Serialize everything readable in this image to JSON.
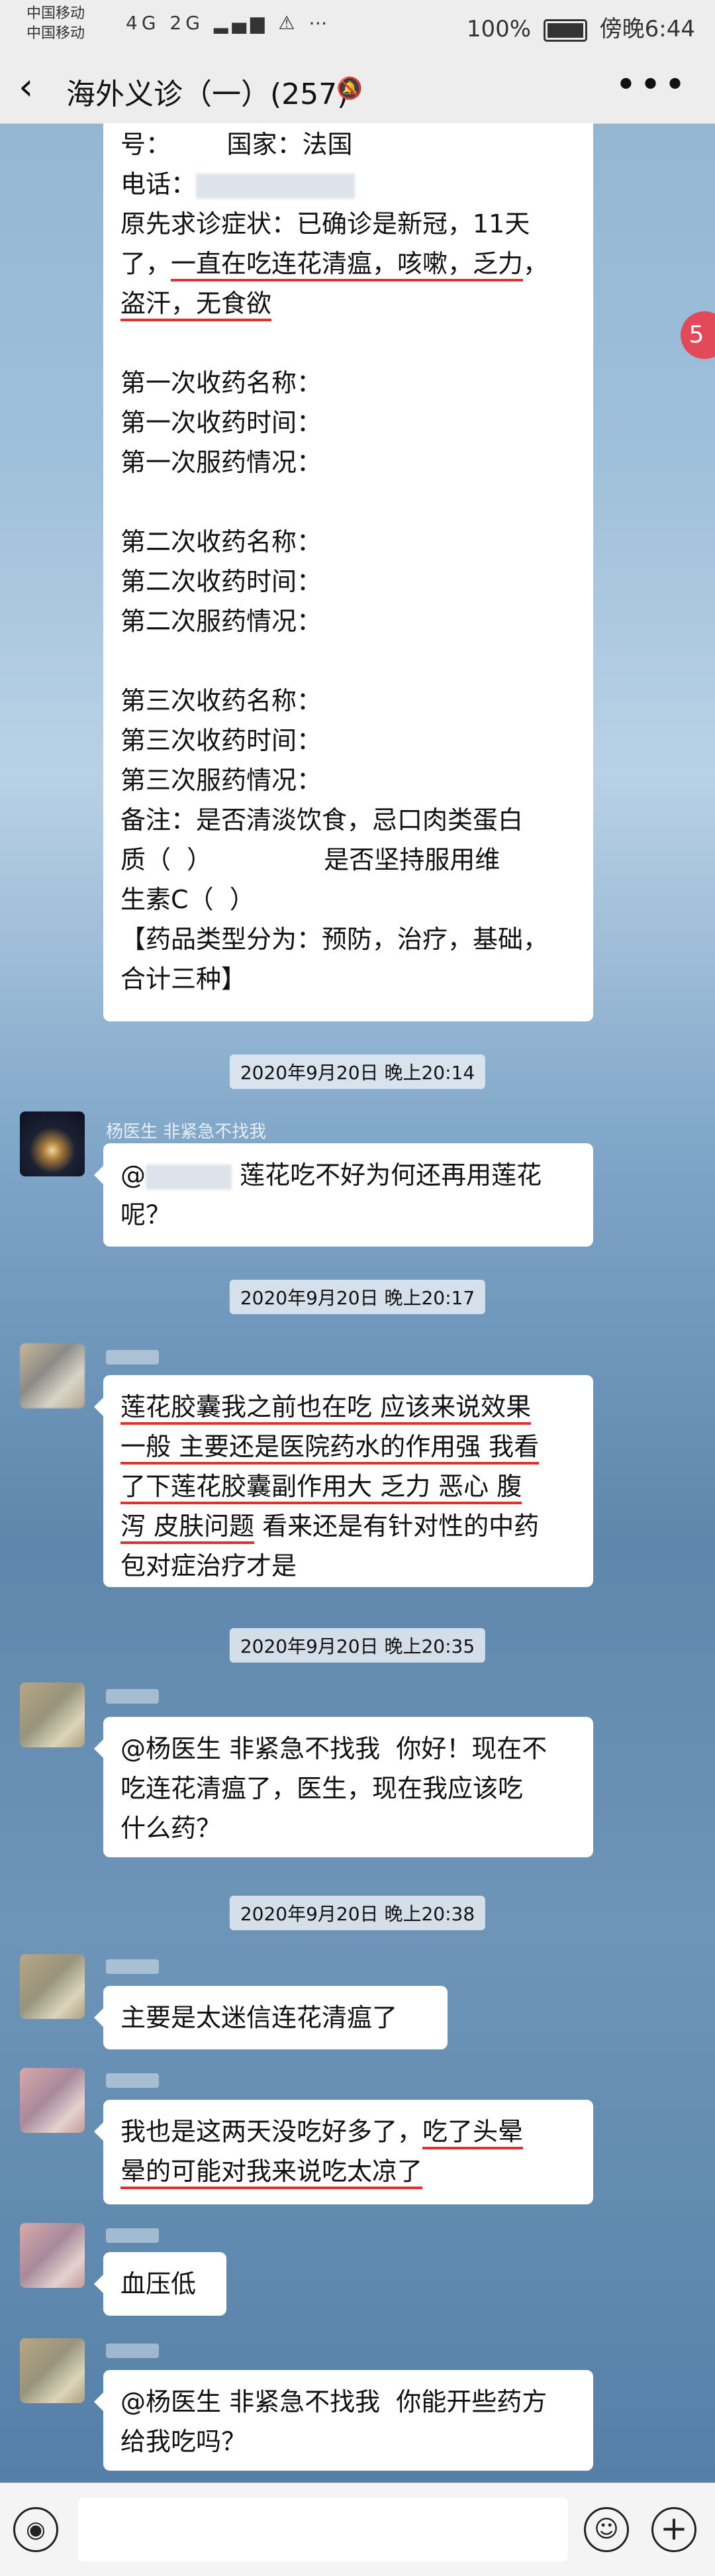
{
  "status": {
    "carrier1": "中国移动",
    "carrier2": "中国移动",
    "net": "4G 2G",
    "battery": "100%",
    "time": "傍晚6:44"
  },
  "header": {
    "back": "‹",
    "title": "海外义诊（一）(257)",
    "mute": "🔕",
    "more": "•••"
  },
  "first_message": {
    "lines": [
      "号：       国家：法国",
      "电话：",
      "原先求诊症状：已确诊是新冠，11天",
      "了，",
      "一直在吃连花清瘟，咳嗽，乏力",
      "，",
      "盗汗，无食欲",
      "",
      "第一次收药名称：",
      "第一次收药时间：",
      "第一次服药情况：",
      "",
      "第二次收药名称：",
      "第二次收药时间：",
      "第二次服药情况：",
      "",
      "第三次收药名称：",
      "第三次收药时间：",
      "第三次服药情况：",
      "备注：是否清淡饮食，忌口肉类蛋白",
      "质（  ）              是否坚持服用维",
      "生素C（  ）",
      "【药品类型分为：预防，治疗，基础，",
      "合计三种】"
    ]
  },
  "unread_badge": "5",
  "timestamps": {
    "t1": "2020年9月20日 晚上20:14",
    "t2": "2020年9月20日 晚上20:17",
    "t3": "2020年9月20日 晚上20:35",
    "t4": "2020年9月20日 晚上20:38"
  },
  "messages": {
    "m1_sender": "杨医生 非紧急不找我",
    "m1_a": "@",
    "m1_b": "莲花吃不好为何还再用莲花",
    "m1_c": "呢？",
    "m2_l1": "莲花胶囊我之前也在吃 应该来说效果",
    "m2_l2": "一般 主要还是医院药水的作用强 我看",
    "m2_l3": "了下莲花胶囊副作用大 乏力 恶心 腹",
    "m2_l4a": "泻 皮肤问题",
    "m2_l4b": " 看来还是有针对性的中药",
    "m2_l5": "包对症治疗才是",
    "m3_l1": "@杨医生 非紧急不找我  你好！现在不",
    "m3_l2": "吃连花清瘟了，医生，现在我应该吃",
    "m3_l3": "什么药？",
    "m4": "主要是太迷信连花清瘟了",
    "m5_l1a": "我也是这两天没吃好多了，",
    "m5_l1b": "吃了头晕",
    "m5_l2": "晕的可能对我来说吃太凉了",
    "m6": "血压低",
    "m7_l1": "@杨医生 非紧急不找我  你能开些药方",
    "m7_l2": "给我吃吗？"
  },
  "input": {
    "voice": "◉",
    "emoji": "☺",
    "plus": "+"
  }
}
